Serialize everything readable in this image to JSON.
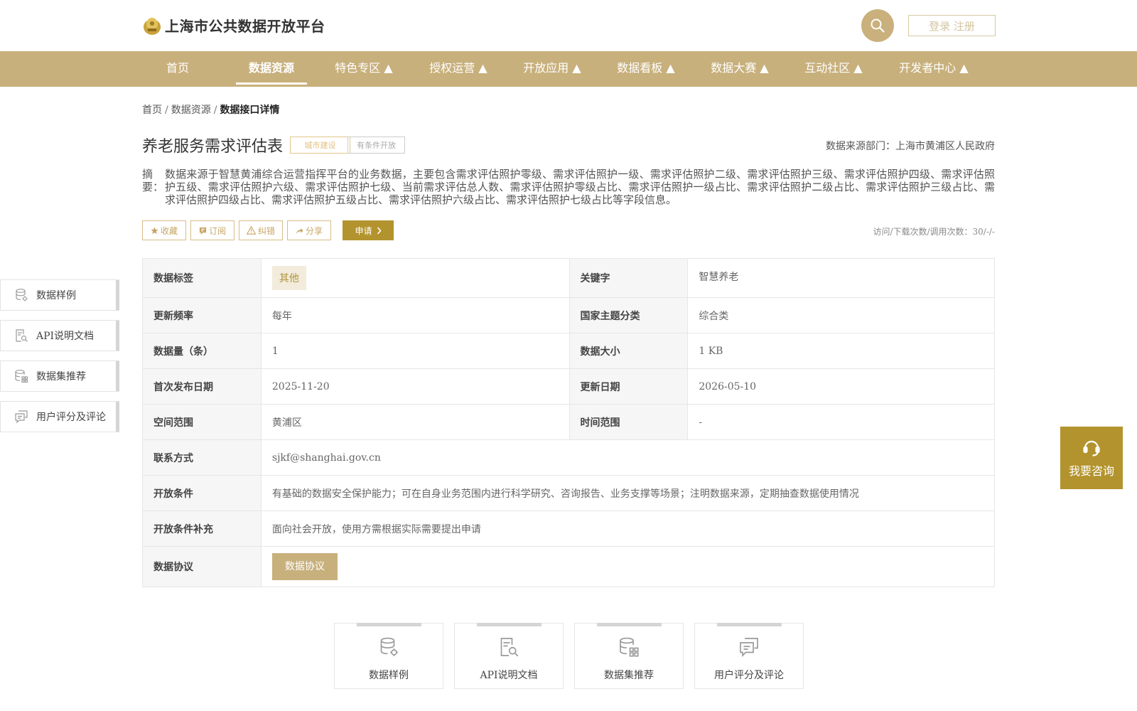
{
  "header": {
    "site_title": "上海市公共数据开放平台",
    "login_label": "登录 注册"
  },
  "nav": [
    {
      "label": "首页"
    },
    {
      "label": "数据资源"
    },
    {
      "label": "特色专区 ▲"
    },
    {
      "label": "授权运营 ▲"
    },
    {
      "label": "开放应用 ▲"
    },
    {
      "label": "数据看板 ▲"
    },
    {
      "label": "数据大赛 ▲"
    },
    {
      "label": "互动社区 ▲"
    },
    {
      "label": "开发者中心 ▲"
    }
  ],
  "breadcrumb": {
    "home": "首页",
    "sep": "/",
    "section": "数据资源",
    "current": "数据接口详情"
  },
  "dataset": {
    "title": "养老服务需求评估表",
    "tag_category": "城市建设",
    "tag_open_type": "有条件开放",
    "source_dept": "数据来源部门：上海市黄浦区人民政府",
    "abstract_label": "摘要：",
    "abstract_text": "数据来源于智慧黄浦综合运营指挥平台的业务数据，主要包含需求评估照护零级、需求评估照护一级、需求评估照护二级、需求评估照护三级、需求评估照护四级、需求评估照护五级、需求评估照护六级、需求评估照护七级、当前需求评估总人数、需求评估照护零级占比、需求评估照护一级占比、需求评估照护二级占比、需求评估照护三级占比、需求评估照护四级占比、需求评估照护五级占比、需求评估照护六级占比、需求评估照护七级占比等字段信息。"
  },
  "actions": {
    "favorite": "收藏",
    "subscribe": "订阅",
    "report_error": "纠错",
    "share": "分享",
    "apply": "申请",
    "visits": "访问/下载次数/调用次数：30/-/-"
  },
  "details": {
    "data_tag_label": "数据标签",
    "data_tag_value": "其他",
    "keyword_label": "关键字",
    "keyword_value": "智慧养老",
    "update_freq_label": "更新频率",
    "update_freq_value": "每年",
    "national_theme_label": "国家主题分类",
    "national_theme_value": "综合类",
    "record_count_label": "数据量（条）",
    "record_count_value": "1",
    "data_size_label": "数据大小",
    "data_size_value": "1 KB",
    "first_publish_label": "首次发布日期",
    "first_publish_value": "2025-11-20",
    "update_date_label": "更新日期",
    "update_date_value": "2026-05-10",
    "spatial_label": "空间范围",
    "spatial_value": "黄浦区",
    "time_range_label": "时间范围",
    "time_range_value": "-",
    "contact_label": "联系方式",
    "contact_value": "sjkf@shanghai.gov.cn",
    "open_cond_label": "开放条件",
    "open_cond_value": "有基础的数据安全保护能力；可在自身业务范围内进行科学研究、咨询报告、业务支撑等场景；注明数据来源，定期抽查数据使用情况",
    "open_cond_extra_label": "开放条件补充",
    "open_cond_extra_value": "面向社会开放，使用方需根据实际需要提出申请",
    "agreement_label": "数据协议",
    "agreement_button": "数据协议"
  },
  "sidebar": [
    {
      "label": "数据样例",
      "icon": "database-gear-icon"
    },
    {
      "label": "API说明文档",
      "icon": "document-search-icon"
    },
    {
      "label": "数据集推荐",
      "icon": "database-grid-icon"
    },
    {
      "label": "用户评分及评论",
      "icon": "chat-bubbles-icon"
    }
  ],
  "consult": {
    "label": "我要咨询",
    "icon": "headset-icon"
  },
  "cards": [
    {
      "label": "数据样例",
      "icon": "database-gear-icon"
    },
    {
      "label": "API说明文档",
      "icon": "document-search-icon"
    },
    {
      "label": "数据集推荐",
      "icon": "database-grid-icon"
    },
    {
      "label": "用户评分及评论",
      "icon": "chat-bubbles-icon"
    }
  ],
  "colors": {
    "brand_gold": "#c8b07c",
    "accent_dark_gold": "#b3932d",
    "tag_orange": "#e3bf7e"
  }
}
